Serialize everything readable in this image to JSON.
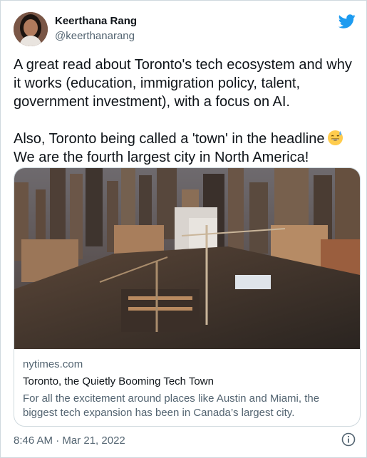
{
  "author": {
    "name": "Keerthana Rang",
    "handle": "@keerthanarang"
  },
  "icons": {
    "logo": "twitter-bird-icon",
    "emoji": "grinning-face-with-sweat-emoji",
    "info": "info-circle-icon"
  },
  "colors": {
    "brand": "#1d9bf0",
    "text": "#0f1419",
    "secondary": "#536471",
    "border": "#cfd9de"
  },
  "tweet": {
    "paragraph1": "A great read about Toronto's tech ecosystem and why it works (education, immigration policy, talent, government investment), with a focus on AI.",
    "paragraph2_before_emoji": "Also, Toronto being called a 'town' in the headline",
    "paragraph2_after_emoji": "We are the fourth largest city in North America!"
  },
  "link_card": {
    "domain": "nytimes.com",
    "title": "Toronto, the Quietly Booming Tech Town",
    "description": "For all the excitement around places like Austin and Miami, the biggest tech expansion has been in Canada’s largest city."
  },
  "timestamp": "8:46 AM · Mar 21, 2022"
}
